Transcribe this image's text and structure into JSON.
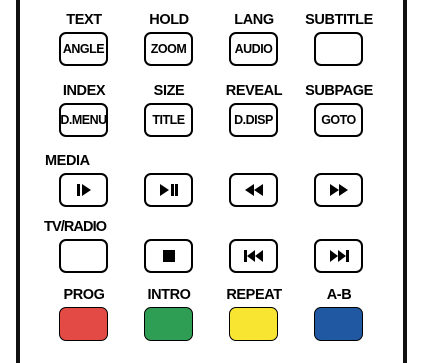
{
  "rows": [
    {
      "cells": [
        {
          "label": "TEXT",
          "button": "ANGLE"
        },
        {
          "label": "HOLD",
          "button": "ZOOM"
        },
        {
          "label": "LANG",
          "button": "AUDIO"
        },
        {
          "label": "SUBTITLE",
          "button": ""
        }
      ]
    },
    {
      "cells": [
        {
          "label": "INDEX",
          "button": "D.MENU"
        },
        {
          "label": "SIZE",
          "button": "TITLE"
        },
        {
          "label": "REVEAL",
          "button": "D.DISP"
        },
        {
          "label": "SUBPAGE",
          "button": "GOTO"
        }
      ]
    }
  ],
  "media_label": "MEDIA",
  "tvradio_label": "TV/RADIO",
  "media_buttons": [
    {
      "icon": "step-forward-icon"
    },
    {
      "icon": "play-pause-icon"
    },
    {
      "icon": "rewind-icon"
    },
    {
      "icon": "fast-forward-icon"
    }
  ],
  "transport_buttons": [
    {
      "icon": ""
    },
    {
      "icon": "stop-icon"
    },
    {
      "icon": "skip-previous-icon"
    },
    {
      "icon": "skip-next-icon"
    }
  ],
  "color_row": {
    "labels": [
      "PROG",
      "INTRO",
      "REPEAT",
      "A-B"
    ],
    "colors": [
      "#e34a45",
      "#2f9e55",
      "#f7e531",
      "#2058a2"
    ],
    "color_names": [
      "red",
      "green",
      "yellow",
      "blue"
    ]
  }
}
